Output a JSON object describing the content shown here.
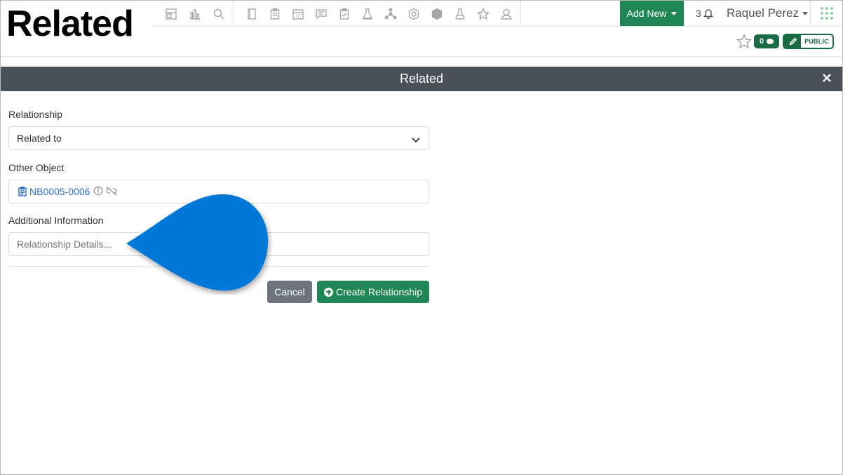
{
  "overlay_title": "Related",
  "toolbar": {
    "icons_group1": [
      "dashboard-icon",
      "bar-chart-icon",
      "search-icon"
    ],
    "icons_group2": [
      "notebook-icon",
      "clipboard-icon",
      "calendar-icon",
      "chat-icon",
      "checklist-icon",
      "lab-icon",
      "network-icon",
      "hexagon-icon",
      "shield-icon",
      "flask-icon",
      "star-icon",
      "user-icon"
    ]
  },
  "header": {
    "add_new_label": "Add New",
    "notification_count": "3",
    "user_name": "Raquel Perez"
  },
  "record_bar": {
    "comment_count": "0",
    "visibility_label": "PUBLIC"
  },
  "modal": {
    "title": "Related",
    "relationship_label": "Relationship",
    "relationship_value": "Related to",
    "other_object_label": "Other Object",
    "other_object_value": "NB0005-0006",
    "additional_info_label": "Additional Information",
    "additional_info_placeholder": "Relationship Details...",
    "cancel_label": "Cancel",
    "create_label": "Create Relationship"
  },
  "colors": {
    "brand_green": "#1e8755",
    "dark_green": "#1a6b44",
    "modal_header": "#495057",
    "cancel_gray": "#6c757d",
    "link_blue": "#2f6fcc",
    "callout_blue": "#0078d7"
  }
}
